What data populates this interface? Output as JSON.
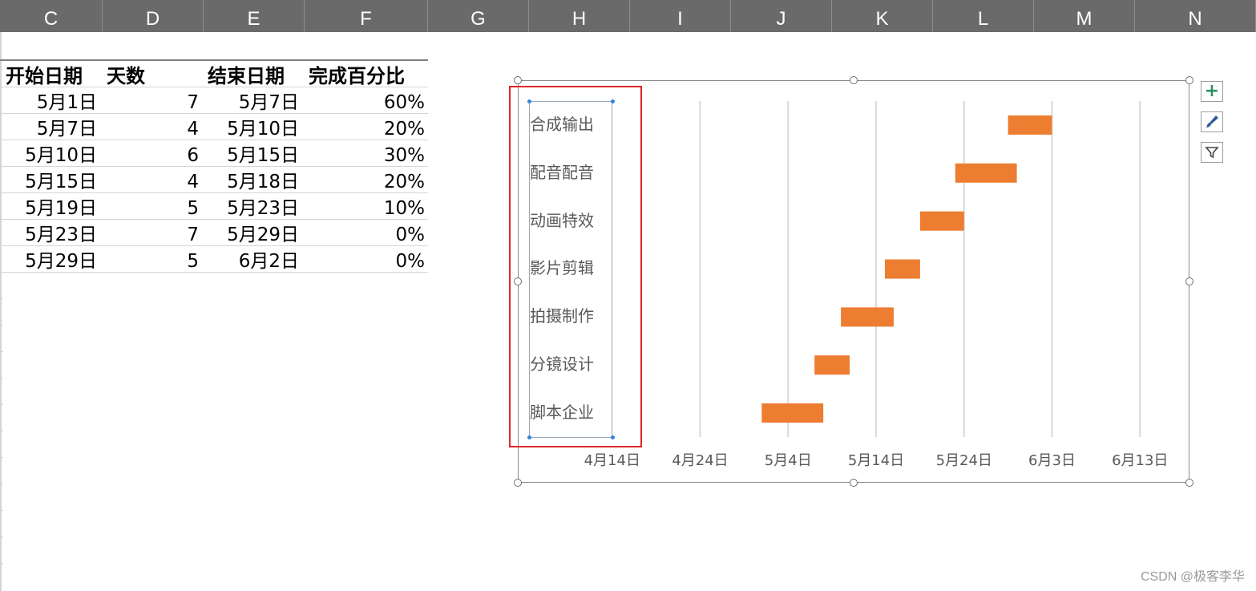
{
  "column_headers": [
    "C",
    "D",
    "E",
    "F",
    "G",
    "H",
    "I",
    "J",
    "K",
    "L",
    "M",
    "N"
  ],
  "table": {
    "headers": {
      "start": "开始日期",
      "days": "天数",
      "end": "结束日期",
      "pct": "完成百分比"
    },
    "rows": [
      {
        "start": "5月1日",
        "days": "7",
        "end": "5月7日",
        "pct": "60%"
      },
      {
        "start": "5月7日",
        "days": "4",
        "end": "5月10日",
        "pct": "20%"
      },
      {
        "start": "5月10日",
        "days": "6",
        "end": "5月15日",
        "pct": "30%"
      },
      {
        "start": "5月15日",
        "days": "4",
        "end": "5月18日",
        "pct": "20%"
      },
      {
        "start": "5月19日",
        "days": "5",
        "end": "5月23日",
        "pct": "10%"
      },
      {
        "start": "5月23日",
        "days": "7",
        "end": "5月29日",
        "pct": "0%"
      },
      {
        "start": "5月29日",
        "days": "5",
        "end": "6月2日",
        "pct": "0%"
      }
    ]
  },
  "chart_buttons": {
    "add": "+",
    "style": "brush-icon",
    "filter": "filter-icon"
  },
  "chart_data": {
    "type": "bar",
    "orientation": "horizontal",
    "subtype": "stacked-gantt",
    "categories": [
      "合成输出",
      "配音配音",
      "动画特效",
      "影片剪辑",
      "拍摄制作",
      "分镜设计",
      "脚本企业"
    ],
    "series": [
      {
        "color": "#ED7D31",
        "start": [
          "5月29日",
          "5月23日",
          "5月19日",
          "5月15日",
          "5月10日",
          "5月7日",
          "5月1日"
        ],
        "days": [
          5,
          7,
          5,
          4,
          6,
          4,
          7
        ]
      }
    ],
    "x_tick_labels": [
      "4月14日",
      "4月24日",
      "5月4日",
      "5月14日",
      "5月24日",
      "6月3日",
      "6月13日"
    ],
    "xlim": [
      "4月4日",
      "6月23日"
    ],
    "grid": true
  },
  "watermark": "CSDN @极客李华"
}
